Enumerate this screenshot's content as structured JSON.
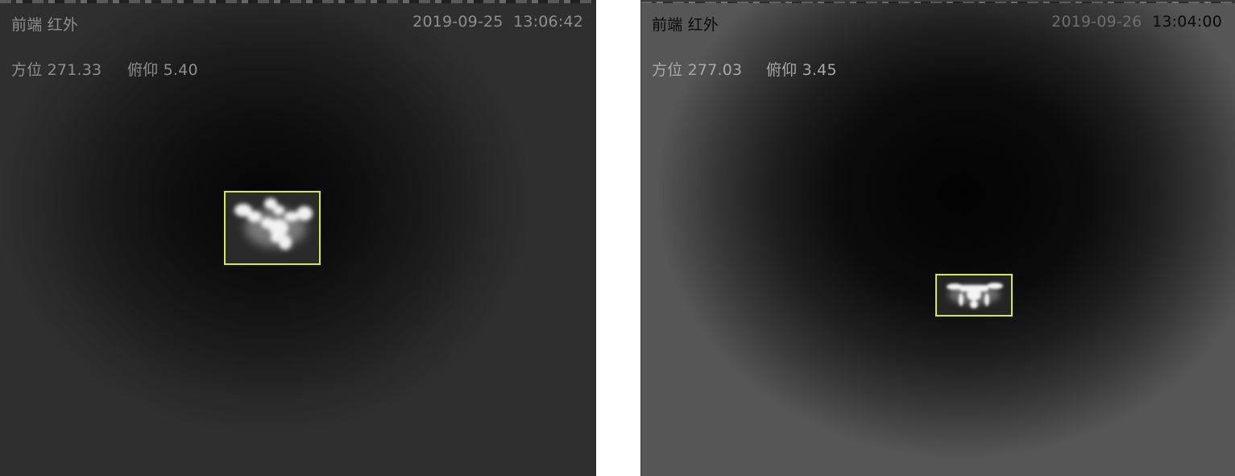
{
  "frames": [
    {
      "source_label": "前端  红外",
      "date": "2019-09-25",
      "time": "13:06:42",
      "azimuth_label": "方位 271.33",
      "elevation_label": "俯仰 5.40",
      "target": "drone"
    },
    {
      "source_label": "前端  红外",
      "date": "2019-09-26",
      "time": "13:04:00",
      "azimuth_label": "方位 277.03",
      "elevation_label": "俯仰 3.45",
      "target": "drone"
    }
  ],
  "colors": {
    "bbox": "#d4ee2b",
    "target": "#f2f2f2"
  }
}
